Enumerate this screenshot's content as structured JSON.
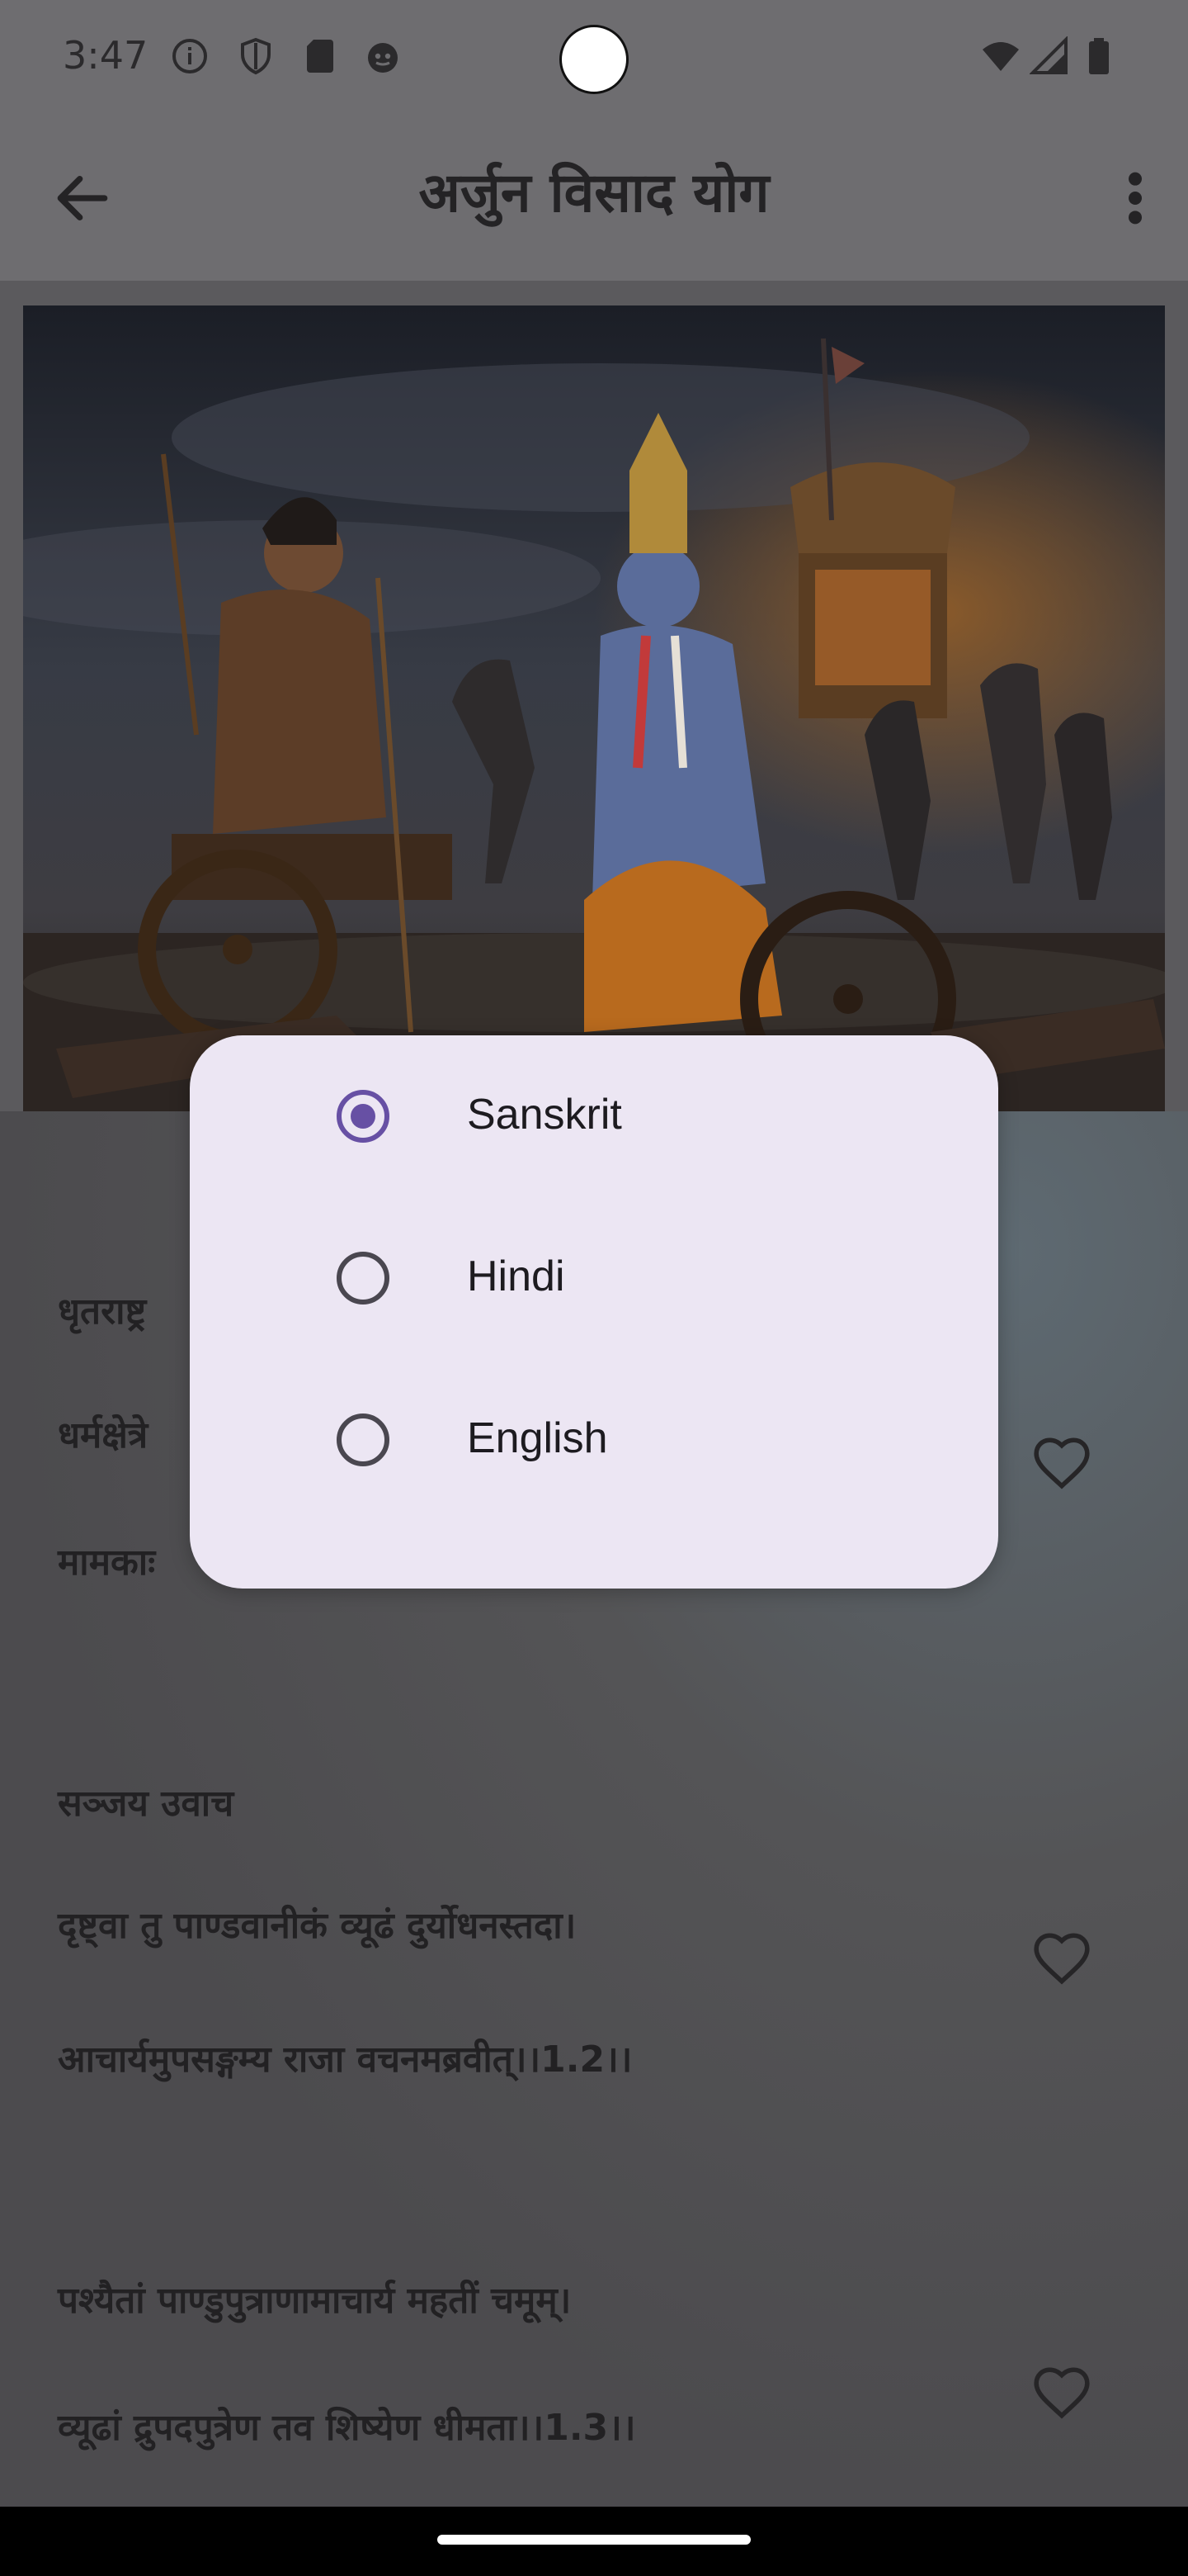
{
  "status_bar": {
    "time": "3:47"
  },
  "app_bar": {
    "title": "अर्जुन विसाद योग"
  },
  "verses": [
    {
      "speaker": "धृतराष्ट्र",
      "line1": "धर्मक्षेत्रे",
      "line2": "मामकाः"
    },
    {
      "speaker": "सञ्जय उवाच",
      "line1": "दृष्ट्वा तु पाण्डवानीकं व्यूढं दुर्योधनस्तदा।",
      "line2": "आचार्यमुपसङ्गम्य राजा वचनमब्रवीत्।।1.2।।"
    },
    {
      "line1": "पश्यैतां पाण्डुपुत्राणामाचार्य महतीं चमूम्।",
      "line2": "व्यूढां द्रुपदपुत्रेण तव शिष्येण धीमता।।1.3।।"
    }
  ],
  "language_dialog": {
    "options": [
      {
        "label": "Sanskrit",
        "selected": true
      },
      {
        "label": "Hindi",
        "selected": false
      },
      {
        "label": "English",
        "selected": false
      }
    ]
  },
  "colors": {
    "accent": "#6750a4",
    "dialog_bg": "#ece6f3",
    "scrim": "#5b5a5d"
  }
}
